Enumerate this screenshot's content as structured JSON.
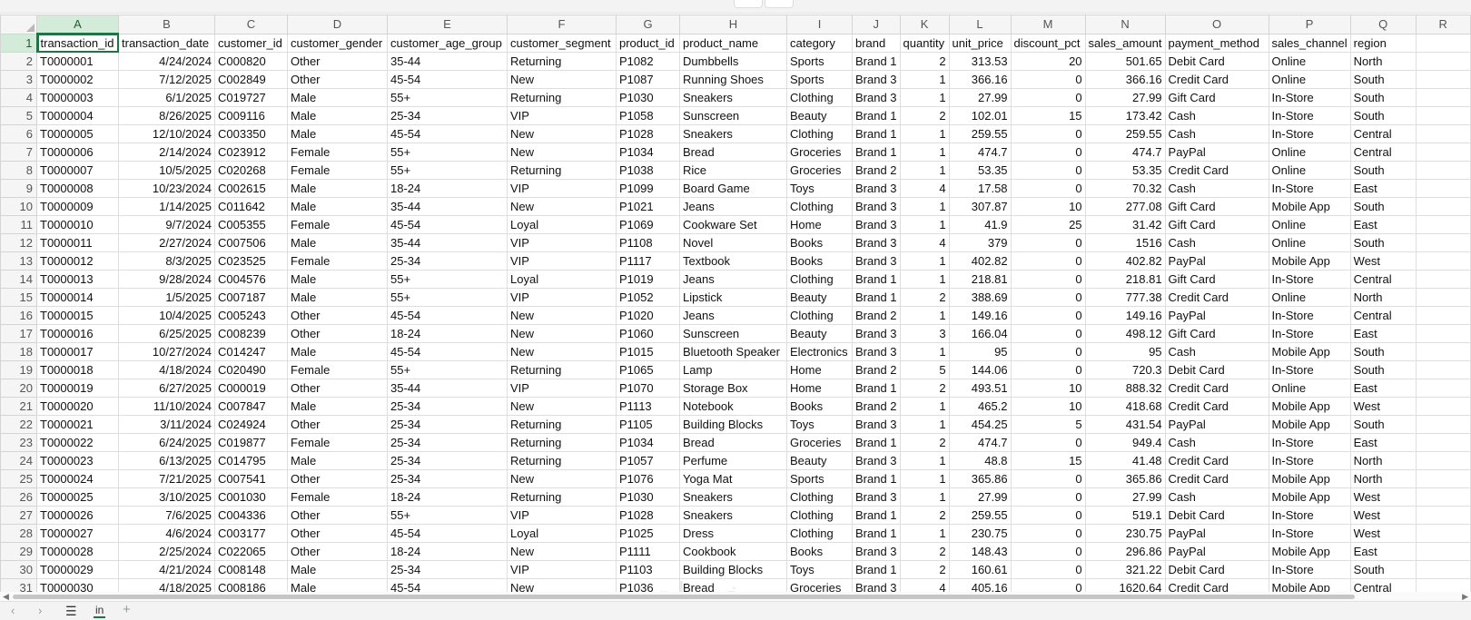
{
  "active_cell": "A1",
  "accent_color": "#217346",
  "column_letters": [
    "A",
    "B",
    "C",
    "D",
    "E",
    "F",
    "G",
    "H",
    "I",
    "J",
    "K",
    "L",
    "M",
    "N",
    "O",
    "P",
    "Q",
    "R"
  ],
  "headers": [
    "transaction_id",
    "transaction_date",
    "customer_id",
    "customer_gender",
    "customer_age_group",
    "customer_segment",
    "product_id",
    "product_name",
    "category",
    "brand",
    "quantity",
    "unit_price",
    "discount_pct",
    "sales_amount",
    "payment_method",
    "sales_channel",
    "region"
  ],
  "rows": [
    [
      "T0000001",
      "4/24/2024",
      "C000820",
      "Other",
      "35-44",
      "Returning",
      "P1082",
      "Dumbbells",
      "Sports",
      "Brand 1",
      "2",
      "313.53",
      "20",
      "501.65",
      "Debit Card",
      "Online",
      "North"
    ],
    [
      "T0000002",
      "7/12/2025",
      "C002849",
      "Other",
      "45-54",
      "New",
      "P1087",
      "Running Shoes",
      "Sports",
      "Brand 3",
      "1",
      "366.16",
      "0",
      "366.16",
      "Credit Card",
      "Online",
      "South"
    ],
    [
      "T0000003",
      "6/1/2025",
      "C019727",
      "Male",
      "55+",
      "Returning",
      "P1030",
      "Sneakers",
      "Clothing",
      "Brand 3",
      "1",
      "27.99",
      "0",
      "27.99",
      "Gift Card",
      "In-Store",
      "South"
    ],
    [
      "T0000004",
      "8/26/2025",
      "C009116",
      "Male",
      "25-34",
      "VIP",
      "P1058",
      "Sunscreen",
      "Beauty",
      "Brand 1",
      "2",
      "102.01",
      "15",
      "173.42",
      "Cash",
      "In-Store",
      "South"
    ],
    [
      "T0000005",
      "12/10/2024",
      "C003350",
      "Male",
      "45-54",
      "New",
      "P1028",
      "Sneakers",
      "Clothing",
      "Brand 1",
      "1",
      "259.55",
      "0",
      "259.55",
      "Cash",
      "In-Store",
      "Central"
    ],
    [
      "T0000006",
      "2/14/2024",
      "C023912",
      "Female",
      "55+",
      "New",
      "P1034",
      "Bread",
      "Groceries",
      "Brand 1",
      "1",
      "474.7",
      "0",
      "474.7",
      "PayPal",
      "Online",
      "Central"
    ],
    [
      "T0000007",
      "10/5/2025",
      "C020268",
      "Female",
      "55+",
      "Returning",
      "P1038",
      "Rice",
      "Groceries",
      "Brand 2",
      "1",
      "53.35",
      "0",
      "53.35",
      "Credit Card",
      "Online",
      "South"
    ],
    [
      "T0000008",
      "10/23/2024",
      "C002615",
      "Male",
      "18-24",
      "VIP",
      "P1099",
      "Board Game",
      "Toys",
      "Brand 3",
      "4",
      "17.58",
      "0",
      "70.32",
      "Cash",
      "In-Store",
      "East"
    ],
    [
      "T0000009",
      "1/14/2025",
      "C011642",
      "Male",
      "35-44",
      "New",
      "P1021",
      "Jeans",
      "Clothing",
      "Brand 3",
      "1",
      "307.87",
      "10",
      "277.08",
      "Gift Card",
      "Mobile App",
      "South"
    ],
    [
      "T0000010",
      "9/7/2024",
      "C005355",
      "Female",
      "45-54",
      "Loyal",
      "P1069",
      "Cookware Set",
      "Home",
      "Brand 3",
      "1",
      "41.9",
      "25",
      "31.42",
      "Gift Card",
      "Online",
      "East"
    ],
    [
      "T0000011",
      "2/27/2024",
      "C007506",
      "Male",
      "35-44",
      "VIP",
      "P1108",
      "Novel",
      "Books",
      "Brand 3",
      "4",
      "379",
      "0",
      "1516",
      "Cash",
      "Online",
      "South"
    ],
    [
      "T0000012",
      "8/3/2025",
      "C023525",
      "Female",
      "25-34",
      "VIP",
      "P1117",
      "Textbook",
      "Books",
      "Brand 3",
      "1",
      "402.82",
      "0",
      "402.82",
      "PayPal",
      "Mobile App",
      "West"
    ],
    [
      "T0000013",
      "9/28/2024",
      "C004576",
      "Male",
      "55+",
      "Loyal",
      "P1019",
      "Jeans",
      "Clothing",
      "Brand 1",
      "1",
      "218.81",
      "0",
      "218.81",
      "Gift Card",
      "In-Store",
      "Central"
    ],
    [
      "T0000014",
      "1/5/2025",
      "C007187",
      "Male",
      "55+",
      "VIP",
      "P1052",
      "Lipstick",
      "Beauty",
      "Brand 1",
      "2",
      "388.69",
      "0",
      "777.38",
      "Credit Card",
      "Online",
      "North"
    ],
    [
      "T0000015",
      "10/4/2025",
      "C005243",
      "Other",
      "45-54",
      "New",
      "P1020",
      "Jeans",
      "Clothing",
      "Brand 2",
      "1",
      "149.16",
      "0",
      "149.16",
      "PayPal",
      "In-Store",
      "Central"
    ],
    [
      "T0000016",
      "6/25/2025",
      "C008239",
      "Other",
      "18-24",
      "New",
      "P1060",
      "Sunscreen",
      "Beauty",
      "Brand 3",
      "3",
      "166.04",
      "0",
      "498.12",
      "Gift Card",
      "In-Store",
      "East"
    ],
    [
      "T0000017",
      "10/27/2024",
      "C014247",
      "Male",
      "45-54",
      "New",
      "P1015",
      "Bluetooth Speaker",
      "Electronics",
      "Brand 3",
      "1",
      "95",
      "0",
      "95",
      "Cash",
      "Mobile App",
      "South"
    ],
    [
      "T0000018",
      "4/18/2024",
      "C020490",
      "Female",
      "55+",
      "Returning",
      "P1065",
      "Lamp",
      "Home",
      "Brand 2",
      "5",
      "144.06",
      "0",
      "720.3",
      "Debit Card",
      "In-Store",
      "South"
    ],
    [
      "T0000019",
      "6/27/2025",
      "C000019",
      "Other",
      "35-44",
      "VIP",
      "P1070",
      "Storage Box",
      "Home",
      "Brand 1",
      "2",
      "493.51",
      "10",
      "888.32",
      "Credit Card",
      "Online",
      "East"
    ],
    [
      "T0000020",
      "11/10/2024",
      "C007847",
      "Male",
      "25-34",
      "New",
      "P1113",
      "Notebook",
      "Books",
      "Brand 2",
      "1",
      "465.2",
      "10",
      "418.68",
      "Credit Card",
      "Mobile App",
      "West"
    ],
    [
      "T0000021",
      "3/11/2024",
      "C024924",
      "Other",
      "25-34",
      "Returning",
      "P1105",
      "Building Blocks",
      "Toys",
      "Brand 3",
      "1",
      "454.25",
      "5",
      "431.54",
      "PayPal",
      "Mobile App",
      "South"
    ],
    [
      "T0000022",
      "6/24/2025",
      "C019877",
      "Female",
      "25-34",
      "Returning",
      "P1034",
      "Bread",
      "Groceries",
      "Brand 1",
      "2",
      "474.7",
      "0",
      "949.4",
      "Cash",
      "In-Store",
      "East"
    ],
    [
      "T0000023",
      "6/13/2025",
      "C014795",
      "Male",
      "25-34",
      "Returning",
      "P1057",
      "Perfume",
      "Beauty",
      "Brand 3",
      "1",
      "48.8",
      "15",
      "41.48",
      "Credit Card",
      "In-Store",
      "North"
    ],
    [
      "T0000024",
      "7/21/2025",
      "C007541",
      "Other",
      "25-34",
      "New",
      "P1076",
      "Yoga Mat",
      "Sports",
      "Brand 1",
      "1",
      "365.86",
      "0",
      "365.86",
      "Credit Card",
      "Mobile App",
      "North"
    ],
    [
      "T0000025",
      "3/10/2025",
      "C001030",
      "Female",
      "18-24",
      "Returning",
      "P1030",
      "Sneakers",
      "Clothing",
      "Brand 3",
      "1",
      "27.99",
      "0",
      "27.99",
      "Cash",
      "Mobile App",
      "West"
    ],
    [
      "T0000026",
      "7/6/2025",
      "C004336",
      "Other",
      "55+",
      "VIP",
      "P1028",
      "Sneakers",
      "Clothing",
      "Brand 1",
      "2",
      "259.55",
      "0",
      "519.1",
      "Debit Card",
      "In-Store",
      "West"
    ],
    [
      "T0000027",
      "4/6/2024",
      "C003177",
      "Other",
      "45-54",
      "Loyal",
      "P1025",
      "Dress",
      "Clothing",
      "Brand 1",
      "1",
      "230.75",
      "0",
      "230.75",
      "PayPal",
      "In-Store",
      "West"
    ],
    [
      "T0000028",
      "2/25/2024",
      "C022065",
      "Other",
      "18-24",
      "New",
      "P1111",
      "Cookbook",
      "Books",
      "Brand 3",
      "2",
      "148.43",
      "0",
      "296.86",
      "PayPal",
      "Mobile App",
      "East"
    ],
    [
      "T0000029",
      "4/21/2024",
      "C008148",
      "Male",
      "25-34",
      "VIP",
      "P1103",
      "Building Blocks",
      "Toys",
      "Brand 1",
      "2",
      "160.61",
      "0",
      "321.22",
      "Debit Card",
      "In-Store",
      "South"
    ],
    [
      "T0000030",
      "4/18/2025",
      "C008186",
      "Male",
      "45-54",
      "New",
      "P1036",
      "Bread",
      "Groceries",
      "Brand 3",
      "4",
      "405.16",
      "0",
      "1620.64",
      "Credit Card",
      "Mobile App",
      "Central"
    ]
  ],
  "sheet_bar": {
    "prev_icon": "chevron-left-icon",
    "next_icon": "chevron-right-icon",
    "prev_glyph": "‹",
    "next_glyph": "›",
    "sheets_list_glyph": "☰",
    "sheet_tab_label": "in",
    "add_glyph": "+"
  }
}
